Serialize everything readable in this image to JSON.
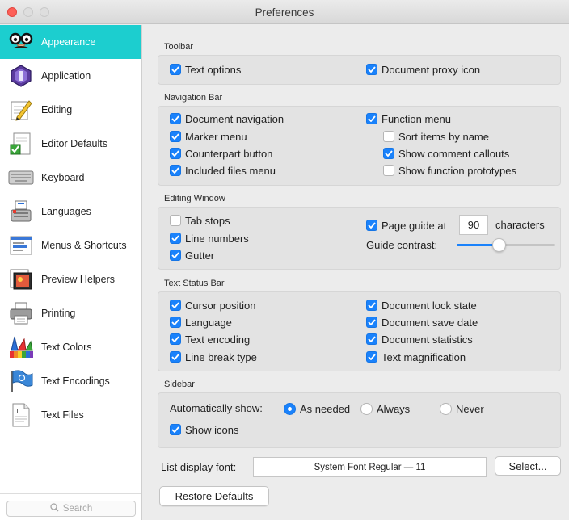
{
  "window": {
    "title": "Preferences"
  },
  "sidebar": {
    "items": [
      {
        "label": "Appearance",
        "icon": "glasses-disguise-icon",
        "selected": true
      },
      {
        "label": "Application",
        "icon": "bbedit-app-icon",
        "selected": false
      },
      {
        "label": "Editing",
        "icon": "pencil-paper-icon",
        "selected": false
      },
      {
        "label": "Editor Defaults",
        "icon": "document-checkmark-icon",
        "selected": false
      },
      {
        "label": "Keyboard",
        "icon": "keyboard-icon",
        "selected": false
      },
      {
        "label": "Languages",
        "icon": "languages-icon",
        "selected": false
      },
      {
        "label": "Menus & Shortcuts",
        "icon": "menus-icon",
        "selected": false
      },
      {
        "label": "Preview Helpers",
        "icon": "preview-icon",
        "selected": false
      },
      {
        "label": "Printing",
        "icon": "printer-icon",
        "selected": false
      },
      {
        "label": "Text Colors",
        "icon": "color-swatches-icon",
        "selected": false
      },
      {
        "label": "Text Encodings",
        "icon": "un-flag-icon",
        "selected": false
      },
      {
        "label": "Text Files",
        "icon": "text-file-icon",
        "selected": false
      }
    ],
    "search_placeholder": "Search"
  },
  "toolbar_section": {
    "title": "Toolbar",
    "text_options": {
      "label": "Text options",
      "checked": true
    },
    "document_proxy_icon": {
      "label": "Document proxy icon",
      "checked": true
    }
  },
  "navigation_section": {
    "title": "Navigation Bar",
    "document_navigation": {
      "label": "Document navigation",
      "checked": true
    },
    "marker_menu": {
      "label": "Marker menu",
      "checked": true
    },
    "counterpart_button": {
      "label": "Counterpart button",
      "checked": true
    },
    "included_files_menu": {
      "label": "Included files menu",
      "checked": true
    },
    "function_menu": {
      "label": "Function menu",
      "checked": true
    },
    "sort_items_by_name": {
      "label": "Sort items by name",
      "checked": false
    },
    "show_comment_callouts": {
      "label": "Show comment callouts",
      "checked": true
    },
    "show_function_prototypes": {
      "label": "Show function prototypes",
      "checked": false
    }
  },
  "editing_window_section": {
    "title": "Editing Window",
    "tab_stops": {
      "label": "Tab stops",
      "checked": false
    },
    "line_numbers": {
      "label": "Line numbers",
      "checked": true
    },
    "gutter": {
      "label": "Gutter",
      "checked": true
    },
    "page_guide": {
      "label": "Page guide at",
      "checked": true,
      "value": "90",
      "suffix": "characters"
    },
    "guide_contrast": {
      "label": "Guide contrast:",
      "level": 0.43
    }
  },
  "text_status_section": {
    "title": "Text Status Bar",
    "cursor_position": {
      "label": "Cursor position",
      "checked": true
    },
    "language": {
      "label": "Language",
      "checked": true
    },
    "text_encoding": {
      "label": "Text encoding",
      "checked": true
    },
    "line_break_type": {
      "label": "Line break type",
      "checked": true
    },
    "document_lock_state": {
      "label": "Document lock state",
      "checked": true
    },
    "document_save_date": {
      "label": "Document save date",
      "checked": true
    },
    "document_statistics": {
      "label": "Document statistics",
      "checked": true
    },
    "text_magnification": {
      "label": "Text magnification",
      "checked": true
    }
  },
  "sidebar_section": {
    "title": "Sidebar",
    "auto_show_label": "Automatically show:",
    "options": [
      {
        "label": "As needed",
        "selected": true
      },
      {
        "label": "Always",
        "selected": false
      },
      {
        "label": "Never",
        "selected": false
      }
    ],
    "show_icons": {
      "label": "Show icons",
      "checked": true
    }
  },
  "font": {
    "label": "List display font:",
    "value": "System Font Regular — 11",
    "select_button": "Select..."
  },
  "restore_defaults": "Restore Defaults",
  "colors": {
    "accent": "#1a82fb",
    "selection": "#1ccecf"
  }
}
